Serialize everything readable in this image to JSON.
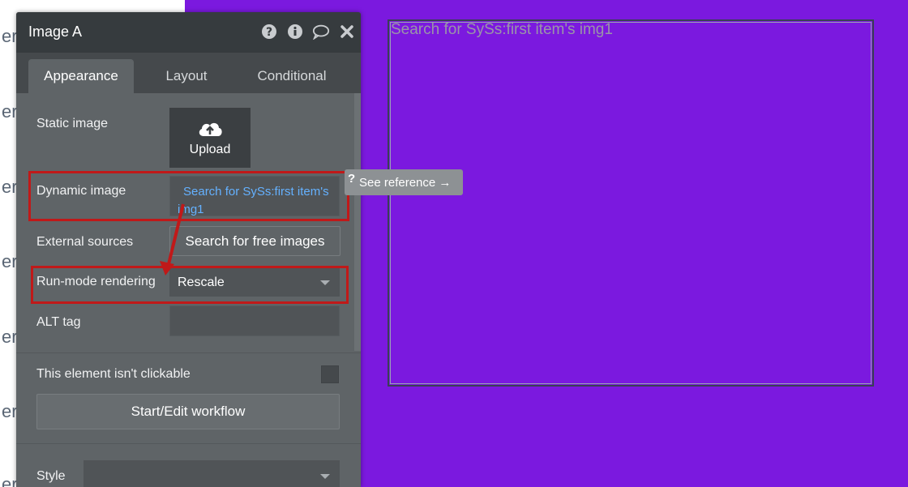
{
  "canvas": {
    "left_fragments": [
      "er",
      "er",
      "er",
      "er",
      "er",
      "er",
      "er",
      "er",
      "er"
    ],
    "image_placeholder": "Search for SySs:first item's img1"
  },
  "panel": {
    "title": "Image A",
    "header_icons": [
      "help-icon",
      "info-icon",
      "comment-icon",
      "close-icon"
    ],
    "tabs": [
      {
        "label": "Appearance",
        "active": true
      },
      {
        "label": "Layout",
        "active": false
      },
      {
        "label": "Conditional",
        "active": false
      }
    ],
    "static_image": {
      "label": "Static image",
      "upload_label": "Upload"
    },
    "dynamic_image": {
      "label": "Dynamic image",
      "value": "Search for SySs:first item's img1"
    },
    "external_sources": {
      "label": "External sources",
      "button": "Search for free images"
    },
    "run_mode": {
      "label": "Run-mode rendering",
      "value": "Rescale"
    },
    "alt_tag": {
      "label": "ALT tag",
      "value": ""
    },
    "clickable": {
      "label": "This element isn't clickable",
      "checked": false
    },
    "workflow_button": "Start/Edit workflow",
    "style": {
      "label": "Style",
      "value": ""
    }
  },
  "tooltip": {
    "label": "See reference →",
    "icon": "?"
  },
  "colors": {
    "canvas": "#7b19df",
    "accent_link": "#64b1ff",
    "annotation": "#c01919"
  }
}
